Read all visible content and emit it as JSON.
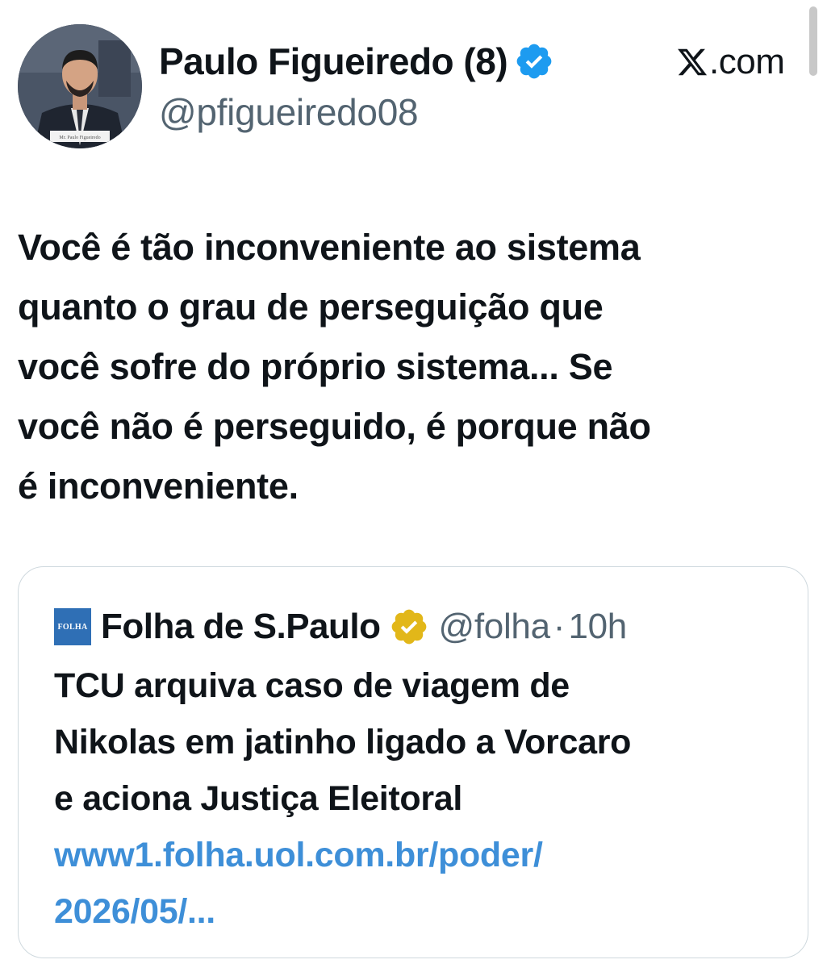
{
  "post": {
    "author": {
      "name": "Paulo Figueiredo (8)",
      "handle": "@pfigueiredo08",
      "verified_icon": "verified-badge-blue",
      "avatar_caption": "Mr. Paulo Figueiredo"
    },
    "platform": {
      "icon": "x-logo",
      "domain": ".com"
    },
    "text_lines": [
      "Você é tão inconveniente ao sistema",
      "quanto o grau de perseguição que",
      "você sofre do próprio sistema... Se",
      "você não é perseguido, é porque não",
      "é inconveniente."
    ]
  },
  "quoted": {
    "logo_text": "FOLHA",
    "name": "Folha de S.Paulo",
    "verified_icon": "verified-badge-gold",
    "handle": "@folha",
    "separator": "·",
    "time": "10h",
    "text_lines": [
      "TCU arquiva caso de viagem de",
      "Nikolas em jatinho ligado a Vorcaro",
      "e aciona Justiça Eleitoral"
    ],
    "link_lines": [
      "www1.folha.uol.com.br/poder/",
      "2026/05/..."
    ]
  },
  "colors": {
    "text": "#0f1419",
    "secondary": "#536471",
    "link": "#3e8fd8",
    "verified_blue": "#1d9bf0",
    "verified_gold": "#e2b719",
    "border": "#cfd9de"
  }
}
